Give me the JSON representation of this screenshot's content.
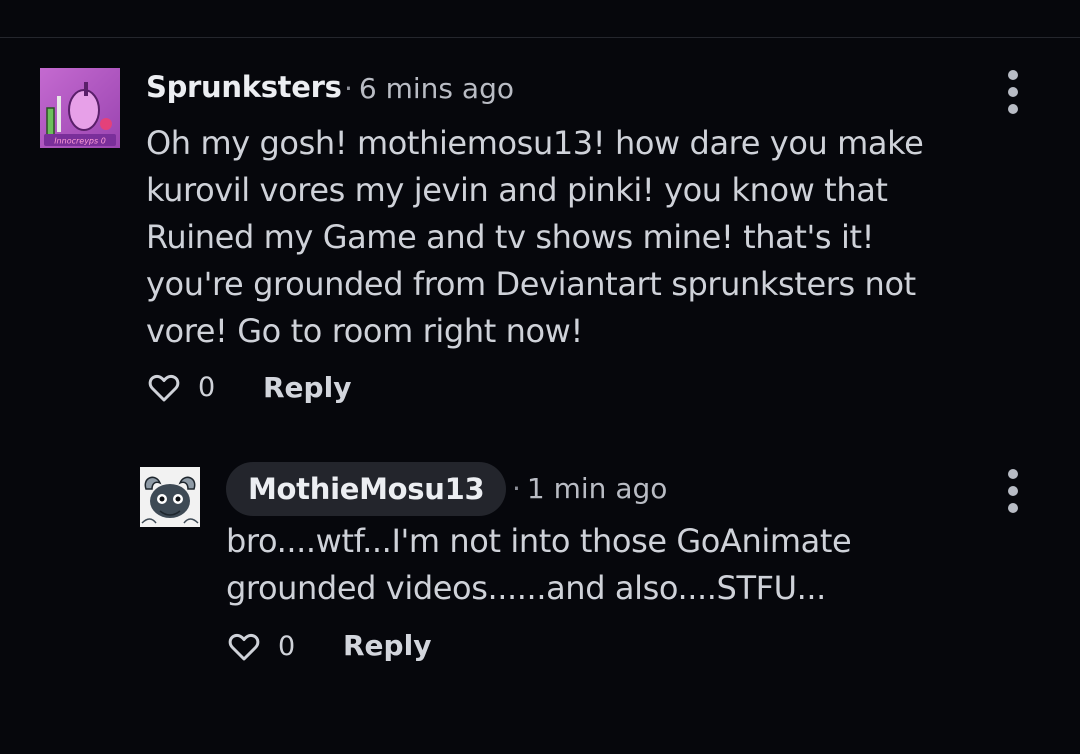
{
  "comments": [
    {
      "username": "Sprunksters",
      "timestamp": "6 mins ago",
      "separator": "·",
      "avatar_text": "Innocreyps 0",
      "body": "Oh my gosh! mothiemosu13! how dare you make\nkurovil vores my jevin and pinki! you know that\nRuined my Game and tv shows mine! that's it!\nyou're grounded from Deviantart sprunksters not\nvore! Go to room right now!",
      "likes": "0",
      "reply_label": "Reply"
    },
    {
      "username": "MothieMosu13",
      "timestamp": "1 min ago",
      "separator": "·",
      "body": "bro....wtf...I'm not into those GoAnimate\ngrounded videos......and also....STFU...",
      "likes": "0",
      "reply_label": "Reply"
    }
  ],
  "icons": {
    "like": "heart-outline-icon",
    "menu": "kebab-menu-icon"
  },
  "colors": {
    "background": "#06070c",
    "text": "#cfd2d9",
    "username": "#eceef2",
    "pill": "#23252c",
    "avatar1_bg": "#b25cc2"
  }
}
